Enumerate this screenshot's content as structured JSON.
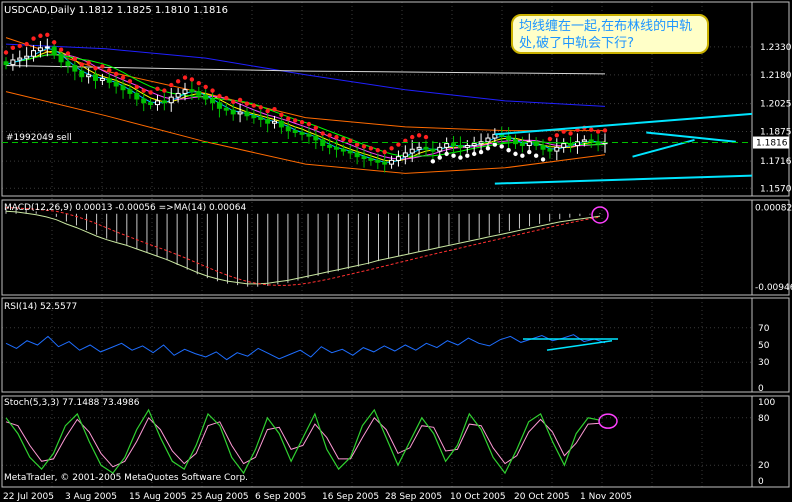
{
  "chart_data": [
    {
      "type": "candlestick",
      "panel": "price",
      "title": "USDCAD,Daily  1.1812 1.1825 1.1810 1.1816",
      "order_label": "#1992049 sell",
      "annotation": "均线缠在一起,在布林线的中轨处,破了中轨会下行?",
      "ylim": [
        1.155,
        1.255
      ],
      "y_ticks": [
        1.233,
        1.218,
        1.2025,
        1.1875,
        1.1716,
        1.157
      ],
      "y_tick_labels": [
        "1.2330",
        "1.2180",
        "1.2025",
        "1.1875",
        "1.1716",
        "1.1570"
      ],
      "last_price": 1.1816,
      "last_price_label": "1.1816",
      "colors": {
        "bull": "#ffffff",
        "bear": "#00c000",
        "sar": "#ff2020",
        "trend": "#00e5ff",
        "bands": "#ff6a00",
        "ma_slow": "#2020ff",
        "ma_white": "#ffffff",
        "ma_yellow": "#ffff00",
        "ma_magenta": "#ff40ff",
        "ma_green": "#00ff00"
      },
      "closes": [
        1.2235,
        1.226,
        1.227,
        1.228,
        1.231,
        1.2325,
        1.233,
        1.229,
        1.225,
        1.223,
        1.22,
        1.217,
        1.218,
        1.215,
        1.216,
        1.214,
        1.212,
        1.21,
        1.208,
        1.205,
        1.203,
        1.202,
        1.204,
        1.203,
        1.206,
        1.208,
        1.21,
        1.209,
        1.207,
        1.205,
        1.203,
        1.2,
        1.199,
        1.197,
        1.198,
        1.196,
        1.195,
        1.194,
        1.192,
        1.193,
        1.19,
        1.188,
        1.187,
        1.186,
        1.185,
        1.183,
        1.18,
        1.179,
        1.178,
        1.177,
        1.176,
        1.174,
        1.173,
        1.172,
        1.171,
        1.17,
        1.172,
        1.174,
        1.176,
        1.178,
        1.179,
        1.178,
        1.177,
        1.179,
        1.181,
        1.18,
        1.179,
        1.18,
        1.181,
        1.182,
        1.184,
        1.186,
        1.185,
        1.183,
        1.181,
        1.18,
        1.182,
        1.18,
        1.178,
        1.177,
        1.179,
        1.181,
        1.18,
        1.182,
        1.183,
        1.182,
        1.181,
        1.1816
      ],
      "bollinger_upper": [
        1.238,
        1.22,
        1.208,
        1.195,
        1.19,
        1.188,
        1.188
      ],
      "bollinger_lower": [
        1.209,
        1.196,
        1.182,
        1.17,
        1.165,
        1.168,
        1.175
      ],
      "sma_slow": [
        1.2345,
        1.232,
        1.227,
        1.218,
        1.21,
        1.204,
        1.201
      ],
      "sma_white_long": [
        1.223,
        1.222,
        1.221,
        1.22,
        1.2195,
        1.219,
        1.2185
      ],
      "trendlines": [
        {
          "x": [
            71,
            127
          ],
          "y": [
            1.1595,
            1.166
          ]
        },
        {
          "x": [
            71,
            127
          ],
          "y": [
            1.186,
            1.2025
          ]
        },
        {
          "x": [
            93,
            106
          ],
          "y": [
            1.187,
            1.182
          ]
        },
        {
          "x": [
            91,
            100
          ],
          "y": [
            1.174,
            1.183
          ]
        }
      ]
    },
    {
      "type": "bar",
      "panel": "macd",
      "title": "MACD(12,26,9) 0.00013 -0.00056 =>MA(14) 0.00064",
      "ylim": [
        -0.0097,
        0.001
      ],
      "y_tick_labels": [
        "0.00082",
        "-0.00946"
      ],
      "y_ticks": [
        0.00082,
        -0.00946
      ],
      "histogram": [
        0.0008,
        0.0007,
        0.0005,
        0.0003,
        0.0,
        -0.0004,
        -0.001,
        -0.0015,
        -0.0021,
        -0.0027,
        -0.0032,
        -0.0036,
        -0.004,
        -0.0045,
        -0.005,
        -0.0055,
        -0.006,
        -0.0066,
        -0.0072,
        -0.0078,
        -0.0083,
        -0.0087,
        -0.009,
        -0.0092,
        -0.0094,
        -0.0094,
        -0.0093,
        -0.0091,
        -0.0089,
        -0.0086,
        -0.0083,
        -0.008,
        -0.0077,
        -0.0074,
        -0.0071,
        -0.0068,
        -0.0065,
        -0.0061,
        -0.0058,
        -0.0055,
        -0.0052,
        -0.0049,
        -0.0046,
        -0.0043,
        -0.004,
        -0.0037,
        -0.0034,
        -0.0031,
        -0.0028,
        -0.0025,
        -0.0022,
        -0.0019,
        -0.0016,
        -0.0013,
        -0.001,
        -0.0007,
        -0.0005,
        -0.0003,
        -0.0001,
        0.0001
      ]
    },
    {
      "type": "line",
      "panel": "rsi",
      "title": "RSI(14) 52.5577",
      "ylim": [
        0,
        100
      ],
      "y_tick_labels": [
        "70",
        "50",
        "30",
        "0"
      ],
      "y_ticks": [
        70,
        50,
        30,
        0
      ],
      "values": [
        52,
        46,
        55,
        50,
        60,
        48,
        54,
        44,
        50,
        42,
        47,
        52,
        44,
        49,
        41,
        50,
        38,
        45,
        40,
        36,
        42,
        33,
        41,
        37,
        46,
        40,
        34,
        39,
        44,
        36,
        48,
        41,
        45,
        38,
        47,
        42,
        49,
        43,
        50,
        44,
        52,
        47,
        55,
        50,
        58,
        52,
        49,
        56,
        60,
        53,
        57,
        61,
        55,
        58,
        62,
        54,
        57,
        52.5577
      ]
    },
    {
      "type": "line",
      "panel": "stoch",
      "title": "Stoch(5,3,3) 77.1488 73.4986",
      "ylim": [
        0,
        100
      ],
      "y_tick_labels": [
        "100",
        "80",
        "20",
        "0"
      ],
      "y_ticks": [
        100,
        80,
        20,
        0
      ],
      "values_main": [
        80,
        60,
        30,
        15,
        35,
        70,
        85,
        50,
        20,
        10,
        30,
        65,
        90,
        55,
        25,
        15,
        45,
        85,
        70,
        30,
        10,
        40,
        80,
        60,
        25,
        55,
        85,
        40,
        15,
        30,
        70,
        90,
        55,
        20,
        50,
        80,
        60,
        25,
        45,
        85,
        65,
        30,
        10,
        40,
        75,
        85,
        50,
        20,
        60,
        80,
        77
      ],
      "values_signal": [
        75,
        70,
        45,
        25,
        28,
        55,
        78,
        62,
        35,
        18,
        25,
        50,
        80,
        65,
        38,
        22,
        35,
        70,
        75,
        45,
        22,
        30,
        65,
        68,
        40,
        45,
        72,
        55,
        28,
        28,
        55,
        80,
        65,
        35,
        42,
        70,
        68,
        38,
        40,
        72,
        70,
        42,
        22,
        32,
        62,
        78,
        62,
        32,
        48,
        72,
        73
      ]
    }
  ],
  "x_axis": {
    "labels": [
      "22 Jul 2005",
      "3 Aug 2005",
      "15 Aug 2005",
      "25 Aug 2005",
      "6 Sep 2005",
      "16 Sep 2005",
      "28 Sep 2005",
      "10 Oct 2005",
      "20 Oct 2005",
      "1 Nov 2005"
    ]
  },
  "footer": {
    "copyright": "MetaTrader, © 2001-2005 MetaQuotes Software Corp."
  }
}
